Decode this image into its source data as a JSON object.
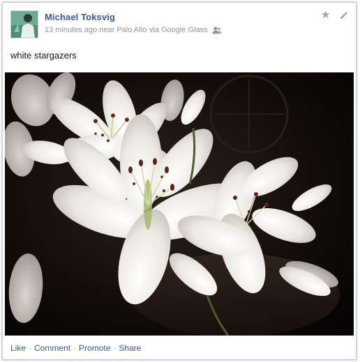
{
  "post": {
    "author": "Michael Toksvig",
    "meta_text": "13 minutes ago near Palo Alto via Google Glass",
    "caption": "white stargazers"
  },
  "icons": {
    "avatar": "profile-photo",
    "audience": "friends-icon",
    "favorite": "star-icon",
    "edit": "pencil-icon"
  },
  "actions": {
    "like": "Like",
    "comment": "Comment",
    "promote": "Promote",
    "share": "Share",
    "separator": "·"
  },
  "colors": {
    "link": "#3b5998",
    "meta": "#90949c",
    "photo_background": "#080504"
  }
}
